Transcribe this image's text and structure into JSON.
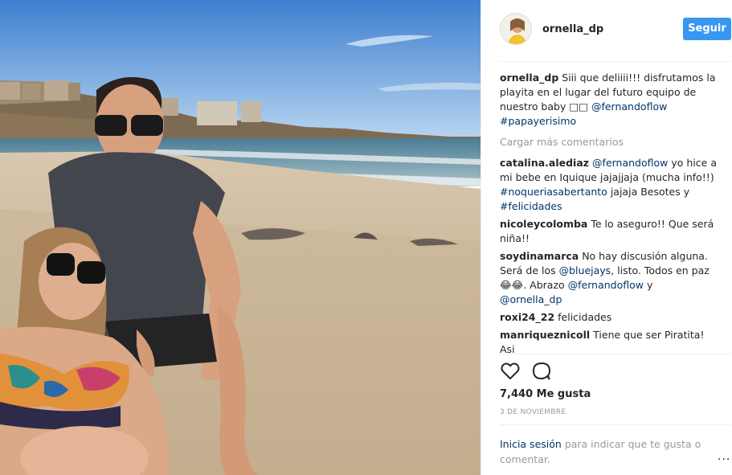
{
  "post": {
    "username": "ornella_dp",
    "follow_label": "Seguir",
    "caption": {
      "user": "ornella_dp",
      "text": "Siii que deliiii!!! disfrutamos la playita en el lugar del futuro equipo de nuestro baby",
      "emoji": "□□",
      "mention": "@fernandoflow",
      "hashtag": "#papayerisimo"
    },
    "load_more_label": "Cargar más comentarios",
    "comments": [
      {
        "user": "catalina.alediaz",
        "mention1": "@fernandoflow",
        "text1": "yo hice a mi bebe en Iquique jajajjaja (mucha info!!)",
        "hashtag1": "#noqueriasabertanto",
        "text2": "jajaja Besotes y",
        "hashtag2": "#felicidades"
      },
      {
        "user": "nicoleycolomba",
        "text": "Te lo aseguro!! Que será niña!!"
      },
      {
        "user": "soydinamarca",
        "text1": "No hay discusión alguna. Será de los",
        "mention1": "@bluejays",
        "text2": ", listo. Todos en paz 😂😂. Abrazo",
        "mention2": "@fernandoflow",
        "text3": "y",
        "mention3": "@ornella_dp"
      },
      {
        "user": "roxi24_22",
        "text": "felicidades"
      },
      {
        "user": "manriqueznicoll",
        "text": "Tiene que ser Piratita! Asi"
      }
    ],
    "like_icon": "heart-outline-icon",
    "comment_icon": "comment-bubble-icon",
    "likes_text": "7,440 Me gusta",
    "date_text": "3 DE NOVIEMBRE",
    "login_link": "Inicia sesión",
    "login_text": "para indicar que te gusta o comentar.",
    "more_label": "..."
  },
  "colors": {
    "follow_button": "#3897f0",
    "link": "#003569",
    "muted": "#999999"
  }
}
